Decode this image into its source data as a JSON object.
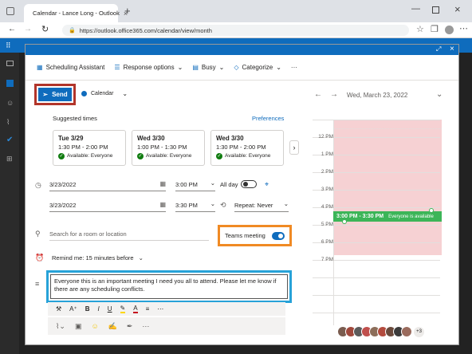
{
  "browser": {
    "tab_title": "Calendar - Lance Long - Outlook",
    "url": "https://outlook.office365.com/calendar/view/month"
  },
  "toolbar": {
    "scheduling_assistant": "Scheduling Assistant",
    "response_options": "Response options",
    "busy": "Busy",
    "categorize": "Categorize",
    "more": "···"
  },
  "send": {
    "label": "Send",
    "calendar_label": "Calendar",
    "calendar_color": "#0f6cbd"
  },
  "suggested": {
    "title": "Suggested times",
    "preferences": "Preferences",
    "cards": [
      {
        "day": "Tue 3/29",
        "time": "1:30 PM - 2:00 PM",
        "status": "Available: Everyone"
      },
      {
        "day": "Wed 3/30",
        "time": "1:00 PM - 1:30 PM",
        "status": "Available: Everyone"
      },
      {
        "day": "Wed 3/30",
        "time": "1:30 PM - 2:00 PM",
        "status": "Available: Everyone"
      }
    ]
  },
  "start": {
    "date": "3/23/2022",
    "time": "3:00 PM",
    "all_day": "All day"
  },
  "end": {
    "date": "3/23/2022",
    "time": "3:30 PM",
    "repeat": "Repeat: Never"
  },
  "location": {
    "placeholder": "Search for a room or location"
  },
  "teams": {
    "label": "Teams meeting",
    "on": true
  },
  "reminder": {
    "label": "Remind me: 15 minutes before"
  },
  "body": {
    "text": "Everyone this is an important meeting I need you all to attend.  Please let me know if there are any scheduling conflicts."
  },
  "format": {
    "bold": "B",
    "italic": "I",
    "underline": "U"
  },
  "calendar": {
    "date": "Wed, March 23, 2022",
    "hours": [
      "12 PM",
      "1 PM",
      "2 PM",
      "3 PM",
      "4 PM",
      "5 PM",
      "6 PM",
      "7 PM"
    ],
    "event_time": "3:00 PM - 3:30 PM",
    "event_note": "Everyone is available",
    "event_color": "#3cb558",
    "busy_color": "#f6d1d3",
    "extra_attendees": "+3"
  },
  "highlights": {
    "send_border": "#b2352a",
    "teams_border": "#f08a24",
    "body_border": "#27a2d8"
  }
}
